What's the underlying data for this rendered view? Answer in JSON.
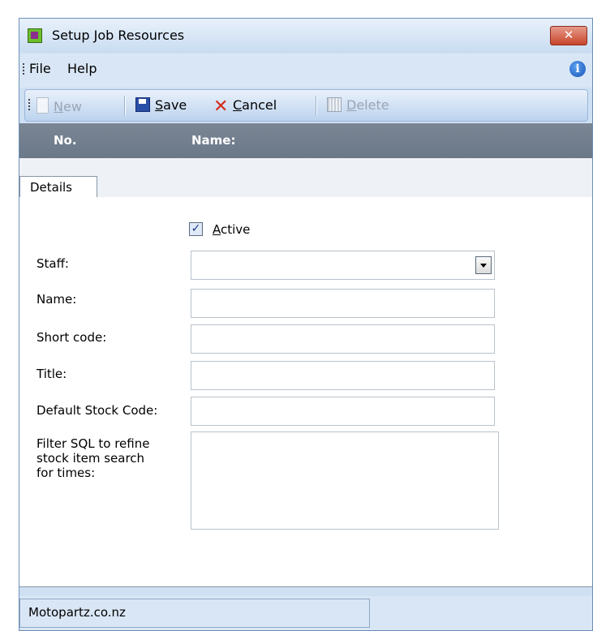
{
  "window": {
    "title": "Setup Job Resources",
    "close_glyph": "✕"
  },
  "menu": {
    "items": [
      "File",
      "Help"
    ],
    "info_glyph": "i"
  },
  "toolbar": {
    "new": {
      "label": "New",
      "accel": "N",
      "rest": "ew",
      "enabled": false
    },
    "save": {
      "label": "Save",
      "accel": "S",
      "rest": "ave",
      "enabled": true
    },
    "cancel": {
      "label": "Cancel",
      "accel": "C",
      "rest": "ancel",
      "enabled": true,
      "glyph": "✕"
    },
    "delete": {
      "label": "Delete",
      "accel": "D",
      "rest": "elete",
      "enabled": false
    }
  },
  "list_header": {
    "col_no": "No.",
    "col_name": "Name:"
  },
  "tabs": [
    {
      "label": "Details",
      "selected": true
    }
  ],
  "form": {
    "active": {
      "accel": "A",
      "rest": "ctive",
      "checked": true,
      "glyph": "✓"
    },
    "staff": {
      "label": "Staff:",
      "value": ""
    },
    "name": {
      "label": "Name:",
      "value": ""
    },
    "short_code": {
      "label": "Short code:",
      "value": ""
    },
    "title": {
      "label": "Title:",
      "value": ""
    },
    "default_stock_code": {
      "label": "Default Stock Code:",
      "value": ""
    },
    "filter_sql": {
      "label_lines": [
        "Filter SQL to refine",
        "stock item search",
        "for times:"
      ],
      "value": ""
    }
  },
  "status": {
    "text": "Motopartz.co.nz"
  }
}
